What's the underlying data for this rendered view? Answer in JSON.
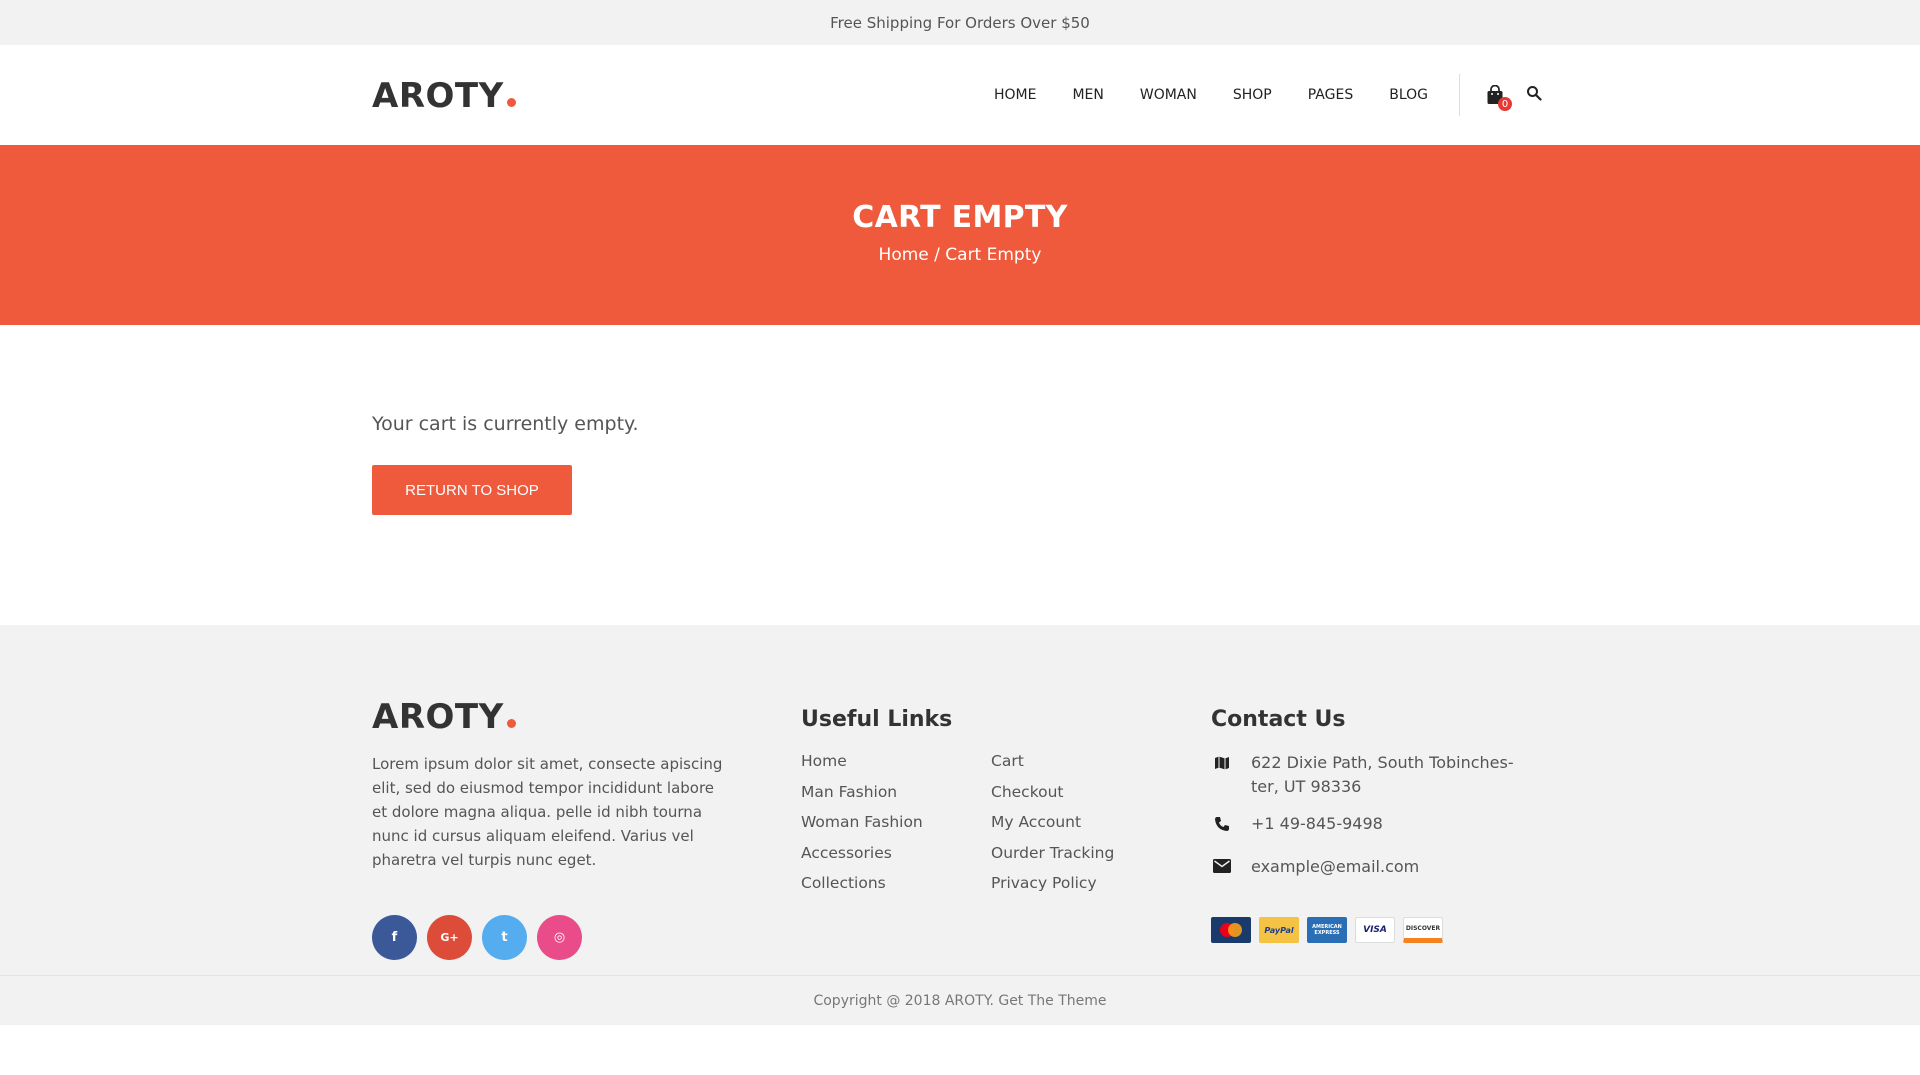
{
  "topbar": {
    "text": "Free Shipping For Orders Over $50"
  },
  "brand": {
    "name": "AROTY",
    "accent": "#ef5a3c"
  },
  "nav": {
    "items": [
      "HOME",
      "MEN",
      "WOMAN",
      "SHOP",
      "PAGES",
      "BLOG"
    ]
  },
  "cart": {
    "count": "0",
    "icon": "shopping-bag-icon"
  },
  "search": {
    "icon": "search-icon"
  },
  "hero": {
    "title": "CART EMPTY",
    "breadcrumb_home": "Home",
    "breadcrumb_sep": " / ",
    "breadcrumb_current": "Cart Empty"
  },
  "main": {
    "empty_message": "Your cart is currently empty.",
    "return_button": "RETURN TO SHOP"
  },
  "footer": {
    "about": "Lorem ipsum dolor sit amet, consecte apiscing elit, sed do eiusmod tempor incididunt  labore et dolore magna aliqua. pelle id nibh tourna nunc id cursus aliquam eleifend. Varius vel pharetra vel turpis nunc eget.",
    "socials": [
      {
        "name": "facebook",
        "glyph": "f",
        "color": "#3b5998"
      },
      {
        "name": "google-plus",
        "glyph": "G+",
        "color": "#dd4b39"
      },
      {
        "name": "twitter",
        "glyph": "t",
        "color": "#55acee"
      },
      {
        "name": "dribbble",
        "glyph": "◎",
        "color": "#ea4c89"
      }
    ],
    "useful_links_title": "Useful Links",
    "links_col1": [
      "Home",
      "Man Fashion",
      "Woman Fashion",
      "Accessories",
      "Collections"
    ],
    "links_col2": [
      "Cart",
      "Checkout",
      "My Account",
      "Ourder Tracking",
      "Privacy Policy"
    ],
    "contact_title": "Contact Us",
    "address": "622 Dixie Path, South Tobinches-ter, UT 98336",
    "address_line1": "622 Dixie Path, South Tobinches-",
    "address_line2": "ter, UT 98336",
    "phone": "+1 49-845-9498",
    "email": "example@email.com",
    "payments": [
      "MasterCard",
      "PayPal",
      "AMERICAN EXPRESS",
      "VISA",
      "DISCOVER"
    ],
    "copyright": "Copyright @ 2018 AROTY. Get The Theme"
  }
}
